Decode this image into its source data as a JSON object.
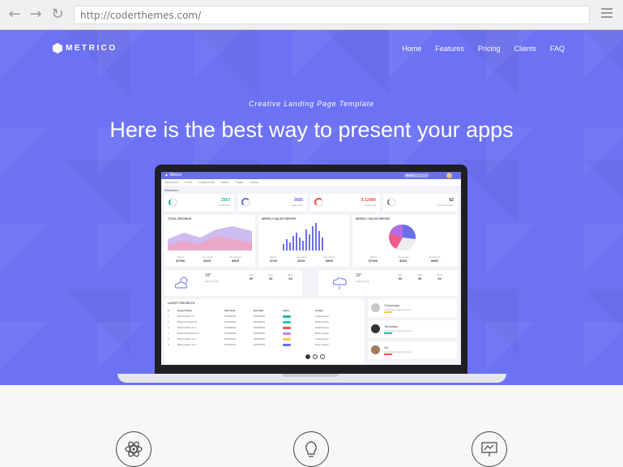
{
  "browser": {
    "url": "http://coderthemes.com/",
    "back_icon": "arrow-left-icon",
    "forward_icon": "arrow-right-icon",
    "reload_icon": "reload-icon",
    "menu_icon": "hamburger-icon"
  },
  "site": {
    "brand": "METRICO",
    "nav": [
      "Home",
      "Features",
      "Pricing",
      "Clients",
      "FAQ"
    ],
    "tagline": "Creative Landing Page Template",
    "headline": "Here is the best way to present your apps",
    "colors": {
      "hero": "#6c72f3",
      "accent": "#6a6fe8"
    }
  },
  "dashboard": {
    "brand": "▲ Minton",
    "search": "Search...",
    "tabs": [
      "Dashboard",
      "UI Kit",
      "Components",
      "Tables",
      "Pages",
      "Extras"
    ],
    "welcome": "Welcome !",
    "stats": [
      {
        "pct": "30%",
        "value": "2563",
        "label": "Total sales",
        "color": "#26b99a"
      },
      {
        "pct": "75%",
        "value": "3685",
        "label": "Total users",
        "color": "#6a6fe8"
      },
      {
        "pct": "55%",
        "value": "$ 12480",
        "label": "Total profit",
        "color": "#f05050"
      },
      {
        "pct": "45%",
        "value": "62",
        "label": "Pending orders",
        "color": "#888888"
      }
    ],
    "charts": [
      {
        "title": "TOTAL REVENUE",
        "stats": [
          {
            "label": "Target",
            "value": "$7000"
          },
          {
            "label": "Last week",
            "value": "$523"
          },
          {
            "label": "Last Month",
            "value": "$965"
          }
        ]
      },
      {
        "title": "WEEKLY SALES REPORT",
        "stats": [
          {
            "label": "Target",
            "value": "$700"
          },
          {
            "label": "Last week",
            "value": "$523"
          },
          {
            "label": "Last Month",
            "value": "$965"
          }
        ]
      },
      {
        "title": "WEEKLY SALES REPORT",
        "stats": [
          {
            "label": "Target",
            "value": "$7000"
          },
          {
            "label": "Last week",
            "value": "$523"
          },
          {
            "label": "Last Month",
            "value": "$965"
          }
        ]
      }
    ],
    "weather": [
      {
        "temp": "33°",
        "desc": "Partly cloudy",
        "days": [
          {
            "d": "SAT",
            "t": "30"
          },
          {
            "d": "SUN",
            "t": "35"
          },
          {
            "d": "MON",
            "t": "33"
          }
        ]
      },
      {
        "temp": "33°",
        "desc": "Partly cloudy",
        "days": [
          {
            "d": "SAT",
            "t": "30"
          },
          {
            "d": "SUN",
            "t": "35"
          },
          {
            "d": "MON",
            "t": "33"
          }
        ]
      }
    ],
    "projects_title": "LATEST PROJECTS",
    "project_cols": [
      "#",
      "Project Name",
      "Start Date",
      "Due Date",
      "Status",
      "Assign"
    ],
    "projects": [
      {
        "n": "1",
        "name": "Minton Admin v1",
        "start": "01/01/2016",
        "due": "26/04/2016",
        "status_color": "#26b99a",
        "assign": "Coderthemes"
      },
      {
        "n": "2",
        "name": "Minton Frontend v1",
        "start": "01/01/2016",
        "due": "26/04/2016",
        "status_color": "#26c6da",
        "assign": "Minton admin"
      },
      {
        "n": "3",
        "name": "Minton Admin v1.1",
        "start": "01/05/2016",
        "due": "10/05/2016",
        "status_color": "#f05050",
        "assign": "Coderthemes"
      },
      {
        "n": "4",
        "name": "Minton Frontend v1.1",
        "start": "01/01/2016",
        "due": "31/05/2016",
        "status_color": "#ad8cf0",
        "assign": "Minton admin"
      },
      {
        "n": "5",
        "name": "Minton Admin v1.3",
        "start": "01/01/2016",
        "due": "31/05/2016",
        "status_color": "#f9c851",
        "assign": "Coderthemes"
      },
      {
        "n": "6",
        "name": "Minton Admin v1.3",
        "start": "01/01/2016",
        "due": "31/05/2016",
        "status_color": "#6a6fe8",
        "assign": "Minton admin"
      }
    ],
    "users": [
      {
        "name": "Chadengle",
        "email": "coderthemes@gmail.com",
        "bar": "#f9c851"
      },
      {
        "name": "Tomaslau",
        "email": "coderthemes@gmail.com",
        "bar": "#26b99a"
      },
      {
        "name": "Ok",
        "email": "coderthemes@gmail.com",
        "bar": "#f05050"
      }
    ]
  },
  "features": [
    "atom-icon",
    "lightbulb-icon",
    "presentation-icon"
  ]
}
